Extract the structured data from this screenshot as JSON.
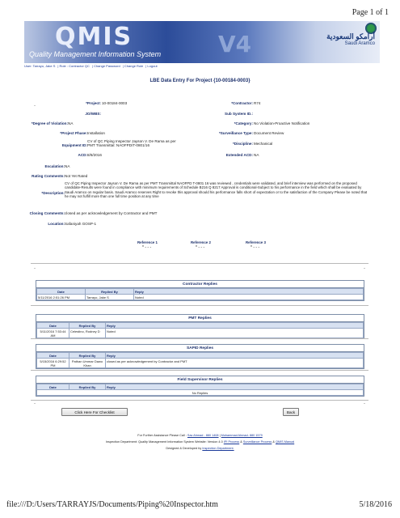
{
  "page_indicator": "Page 1 of 1",
  "banner": {
    "logo_text": "QMIS",
    "subtitle": "Quality Management Information System",
    "version": "V4",
    "brand_arabic": "أرامكو السعودية",
    "brand_english": "Saudi Aramco"
  },
  "userbar": {
    "user": "User: Tarrayo, Jake S",
    "role": "Role : Contractor QC",
    "change_password": "Change Password",
    "change_role": "Change Role",
    "logout": "Logout"
  },
  "title": "LBE Data Entry For Project {10-00184-0003}",
  "form": {
    "project_label": "*Project:",
    "project_value": "10-00184-0003",
    "contractor_label": "*Contractor:",
    "contractor_value": "R74",
    "jowbs_label": "JO/WBS:",
    "jowbs_value": "",
    "subsystem_label": "Sub System ID.:",
    "subsystem_value": "",
    "degree_label": "*Degree of Violation:",
    "degree_value": "NA",
    "category_label": "*Category:",
    "category_value": "No Violation-Proactive Notification",
    "phase_label": "*Project Phase:",
    "phase_value": "Installation",
    "survtype_label": "*Surveillance Type:",
    "survtype_value": "Document Review",
    "equipment_label": "Equipment ID:",
    "equipment_value_line1": "CV of QC Piping Inspector Jayson V. De Rama as per",
    "equipment_value_line2": "PMT Transmittal: NAOFPD/T-0801/16",
    "discipline_label": "*Discipline:",
    "discipline_value": "Mechanical",
    "acd_label": "ACD:",
    "acd_value": "8/8/2016",
    "extended_acd_label": "Extended ACD:",
    "extended_acd_value": "NA",
    "escalation_label": "Escalation:",
    "escalation_value": "NA",
    "rating_label": "Rating Comments:",
    "rating_value": "Not Yet Rated",
    "description_label": "*Description:",
    "description_value": "CV of QC Piping Inspector Jayson V. De Rama as per PMT Transmittal NAOFPD T-0801 16 was reviewed , credentials were validated, and brief interview was performed on the proposed candidate-Results were found in compliance with minimum requirements of Schedule B216 Q 8217 Approval is conditional-Subject to his performance in the field which shall be evaluated by Saudi Aramco on regular basis. Saudi Aramco reserves Right to revoke this approval should his performance falls short of expectation or to the satisfaction of the Company Please be noted that he may not fulfill more than one full time position at any time",
    "closing_label": "Closing Comments:",
    "closing_value": "closed as per acknowledgement by Contractor and PMT",
    "location_label": "Location:",
    "location_value": "Safaniyah GOSP-1"
  },
  "references": [
    {
      "label": "Reference 1",
      "value": "* - - -"
    },
    {
      "label": "Reference 2",
      "value": "* - - -"
    },
    {
      "label": "Reference 3",
      "value": "* - - -"
    }
  ],
  "columns": {
    "date": "Date",
    "replied_by": "Replied By",
    "reply": "Reply"
  },
  "contractor_replies": {
    "title": "Contractor Replies",
    "rows": [
      {
        "date": "5/11/2016 2:51:26 PM",
        "replied_by": "Tarrayo, Jake S",
        "reply": "Noted"
      }
    ]
  },
  "pmt_replies": {
    "title": "PMT Replies",
    "rows": [
      {
        "date": "5/11/2016 7:53:44 AM",
        "replied_by": "Celestino, Rodney D",
        "reply": "Noted"
      }
    ]
  },
  "sapid_replies": {
    "title": "SAPID Replies",
    "rows": [
      {
        "date": "5/15/2016 6:29:52 PM",
        "replied_by": "Pathan Ummar Dawo Khan",
        "reply": "closed as per acknowledgement by Contractor and PMT"
      }
    ]
  },
  "field_supervisor_replies": {
    "title": "Field Supervisor Replies",
    "empty_text": "No Replies"
  },
  "buttons": {
    "checklist": "Click Here For Checklist",
    "back": "Back"
  },
  "footer": {
    "line1_prefix": "For Further Assistance Please Call :",
    "contact1": "Sav Ahmad - 880 1408",
    "contact2": "Mohammad Ahmad- 880 1579",
    "line2_prefix": "Inspection Department: Quality Management Information System Website: Version 4.0",
    "link_process": "IPI Process",
    "link_surveillance": "Surveillance Process",
    "link_qmis": "QMIS Manual",
    "line3_prefix": "Designed & Developed by",
    "link_dept": "Inspection Department."
  },
  "bottom": {
    "file_path": "file:///D:/Users/TARRAYJS/Documents/Piping%20Inspector.htm",
    "print_date": "5/18/2016"
  }
}
